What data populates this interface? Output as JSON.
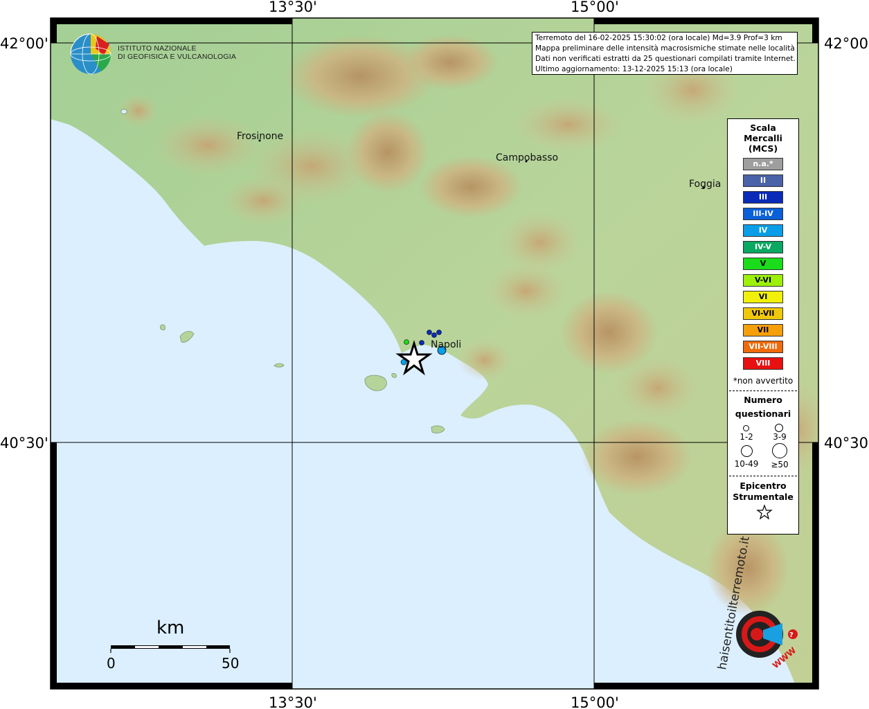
{
  "map": {
    "lat_labels": [
      "42°00'",
      "40°30'"
    ],
    "lon_labels": [
      "13°30'",
      "15°00'"
    ]
  },
  "cities": [
    {
      "name": "Frosinone"
    },
    {
      "name": "Campobasso"
    },
    {
      "name": "Foggia"
    },
    {
      "name": "Napoli"
    }
  ],
  "institute": {
    "line1": "ISTITUTO NAZIONALE",
    "line2": "DI GEOFISICA E VULCANOLOGIA"
  },
  "info": {
    "line1": "Terremoto del 16-02-2025 15:30:02 (ora locale) Md=3.9 Prof=3 km",
    "line2": "Mappa preliminare delle intensità macrosismiche stimate nelle località",
    "line3": "Dati non verificati estratti da 25 questionari compilati tramite Internet.",
    "line4": "Ultimo aggiornamento: 13-12-2025 15:13 (ora locale)"
  },
  "legend": {
    "title_line1": "Scala",
    "title_line2": "Mercalli",
    "title_line3": "(MCS)",
    "scale": [
      {
        "label": "n.a.*",
        "color": "#9e9e9e"
      },
      {
        "label": "II",
        "color": "#4a62a8"
      },
      {
        "label": "III",
        "color": "#0a2bb8"
      },
      {
        "label": "III-IV",
        "color": "#0a60d8"
      },
      {
        "label": "IV",
        "color": "#0a9ee8"
      },
      {
        "label": "IV-V",
        "color": "#0aa860"
      },
      {
        "label": "V",
        "color": "#1adc1a"
      },
      {
        "label": "V-VI",
        "color": "#9cf00a"
      },
      {
        "label": "VI",
        "color": "#f0f00a"
      },
      {
        "label": "VI-VII",
        "color": "#f0c80a"
      },
      {
        "label": "VII",
        "color": "#f5a00a"
      },
      {
        "label": "VII-VIII",
        "color": "#f06a0a"
      },
      {
        "label": "VIII",
        "color": "#e81010"
      }
    ],
    "footnote": "*non avvertito",
    "count_title_line1": "Numero",
    "count_title_line2": "questionari",
    "count_labels": [
      "1-2",
      "3-9",
      "10-49",
      "≥50"
    ],
    "epicenter_line1": "Epicentro",
    "epicenter_line2": "Strumentale"
  },
  "scalebar": {
    "unit": "km",
    "start": "0",
    "end": "50"
  },
  "badge": {
    "site": "haisentitoilterremoto.it",
    "url": "WWW"
  },
  "colors": {
    "sea": "#dcefff",
    "land_low": "#9ac992",
    "land_mid": "#c9d49a",
    "land_high": "#c49a6a",
    "grid": "#000000",
    "epicenter": "#ffffff"
  }
}
